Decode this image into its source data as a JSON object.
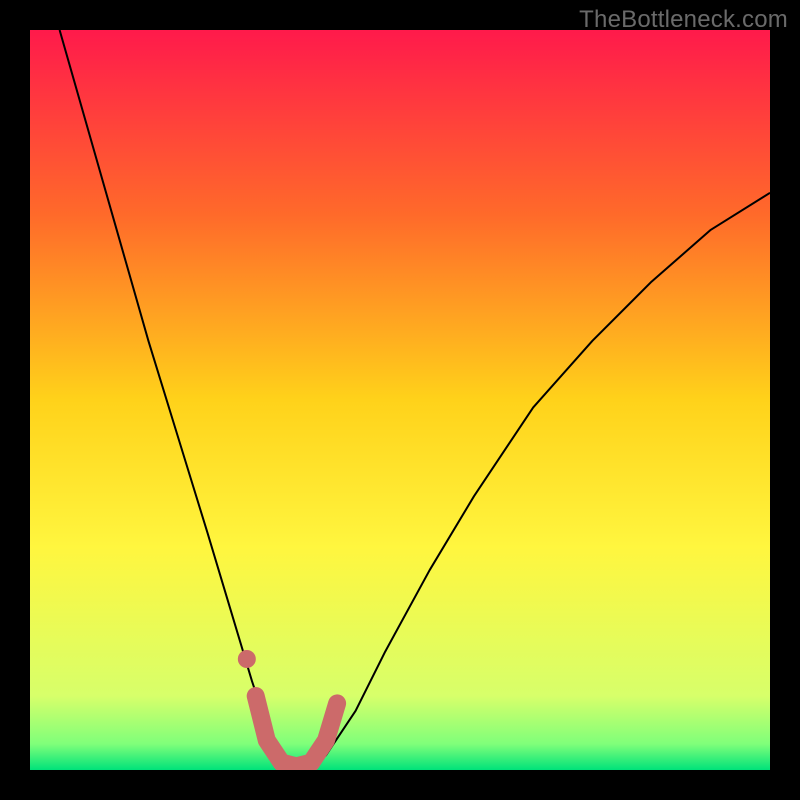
{
  "watermark": "TheBottleneck.com",
  "chart_data": {
    "type": "line",
    "title": "",
    "xlabel": "",
    "ylabel": "",
    "xlim": [
      0,
      100
    ],
    "ylim": [
      0,
      100
    ],
    "legend": false,
    "grid": false,
    "background_gradient_stops": [
      {
        "offset": 0.0,
        "color": "#ff1a4b"
      },
      {
        "offset": 0.25,
        "color": "#ff6a2a"
      },
      {
        "offset": 0.5,
        "color": "#ffd21a"
      },
      {
        "offset": 0.7,
        "color": "#fff63f"
      },
      {
        "offset": 0.9,
        "color": "#d7ff6a"
      },
      {
        "offset": 0.965,
        "color": "#7fff7a"
      },
      {
        "offset": 1.0,
        "color": "#00e27a"
      }
    ],
    "series": [
      {
        "name": "bottleneck-curve",
        "stroke": "#000000",
        "stroke_width": 2,
        "x": [
          4,
          8,
          12,
          16,
          20,
          24,
          27,
          30,
          32,
          34,
          36,
          38,
          40,
          44,
          48,
          54,
          60,
          68,
          76,
          84,
          92,
          100
        ],
        "y": [
          100,
          86,
          72,
          58,
          45,
          32,
          22,
          12,
          6,
          2,
          0,
          0,
          2,
          8,
          16,
          27,
          37,
          49,
          58,
          66,
          73,
          78
        ]
      },
      {
        "name": "highlight-band",
        "stroke": "#cc6a6a",
        "stroke_width": 18,
        "linecap": "round",
        "x": [
          30.5,
          32,
          34,
          36,
          38,
          40,
          41.5
        ],
        "y": [
          10,
          4,
          1,
          0.5,
          1,
          4,
          9
        ]
      },
      {
        "name": "highlight-dot",
        "type": "scatter",
        "fill": "#cc6a6a",
        "radius": 9,
        "x": [
          29.3
        ],
        "y": [
          15
        ]
      }
    ]
  }
}
